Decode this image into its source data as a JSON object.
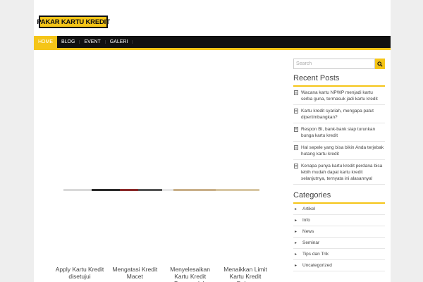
{
  "brand": {
    "logo_text": "PAKAR KARTU KREDIT",
    "accent": "#f5c518",
    "nav_bg": "#111111"
  },
  "nav": {
    "items": [
      {
        "label": "HOME"
      },
      {
        "label": "BLOG"
      },
      {
        "label": "EVENT"
      },
      {
        "label": "GALERI"
      }
    ]
  },
  "main": {
    "posts": [
      {
        "title": "Apply Kartu Kredit disetujui"
      },
      {
        "title": "Mengatasi Kredit Macet"
      },
      {
        "title": "Menyelesaikan Kartu Kredit Bermasalah"
      },
      {
        "title": "Menaikkan Limit Kartu Kredit Dalam"
      }
    ]
  },
  "sidebar": {
    "search": {
      "placeholder": "Search",
      "icon": "search-icon"
    },
    "recent_title": "Recent Posts",
    "recent_posts": [
      {
        "label": "Wacana kartu NPWP menjadi kartu serba guna, termasuk jadi kartu kredit"
      },
      {
        "label": "Kartu kredit syariah, mengapa patut dipertimbangkan?"
      },
      {
        "label": "Respon BI, bank-bank siap turunkan bunga kartu kredit"
      },
      {
        "label": "Hal sepele yang bisa bikin Anda terjebak hutang kartu kredit"
      },
      {
        "label": "Kenapa punya kartu kredit perdana bisa lebih mudah dapat kartu kredit selanjutnya, ternyata ini alasannya!"
      }
    ],
    "categories_title": "Categories",
    "categories": [
      {
        "label": "Artikel"
      },
      {
        "label": "Info"
      },
      {
        "label": "News"
      },
      {
        "label": "Seminar"
      },
      {
        "label": "Tips dan Trik"
      },
      {
        "label": "Uncategorized"
      }
    ]
  }
}
